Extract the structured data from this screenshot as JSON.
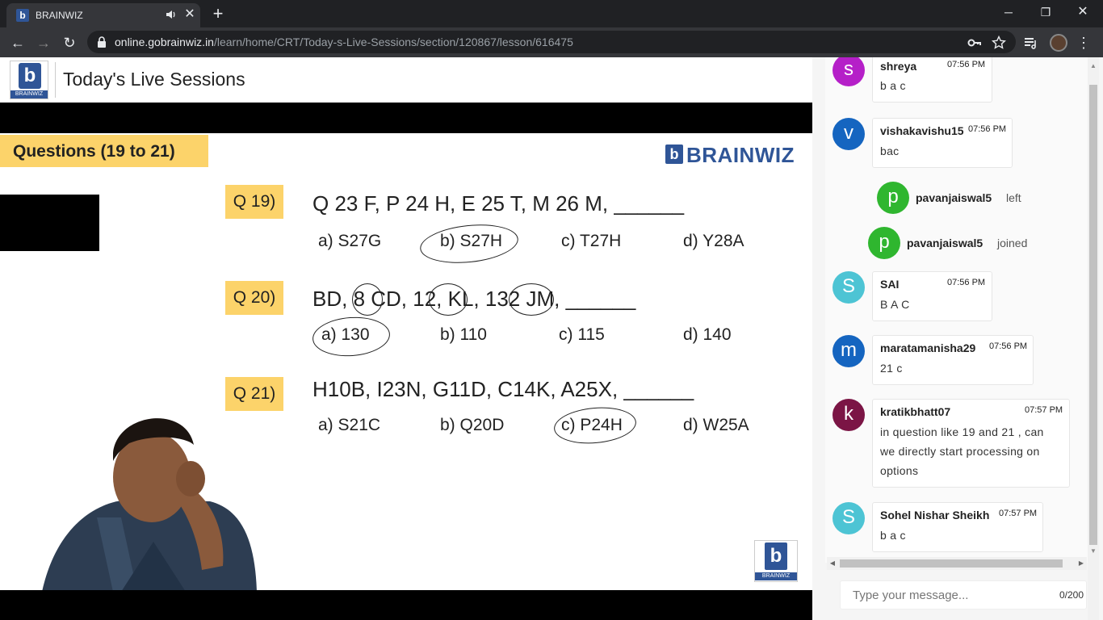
{
  "browser": {
    "tab_title": "BRAINWIZ",
    "new_tab": "+",
    "url_host": "online.gobrainwiz.in",
    "url_path": "/learn/home/CRT/Today-s-Live-Sessions/section/120867/lesson/616475",
    "minimize": "─",
    "restore": "❐",
    "close": "✕",
    "back": "←",
    "forward": "→",
    "reload": "↻",
    "menu": "⋮"
  },
  "site": {
    "logo_text": "BRAINWIZ",
    "page_title": "Today's Live Sessions"
  },
  "slide": {
    "banner": "Questions (19 to 21)",
    "brand": "BRAINWIZ",
    "questions": [
      {
        "label": "Q 19)",
        "text": "Q 23 F,   P 24 H,   E 25 T,   M 26 M,  ______",
        "options": [
          "a) S27G",
          "b) S27H",
          "c) T27H",
          "d) Y28A"
        ]
      },
      {
        "label": "Q 20)",
        "text": "BD,  8  CD,  12,  KL,  132   JM,  ______",
        "options": [
          "a) 130",
          "b) 110",
          "c) 115",
          "d) 140"
        ]
      },
      {
        "label": "Q 21)",
        "text": "H10B,   I23N,   G11D,   C14K,  A25X,  ______",
        "options": [
          "a) S21C",
          "b) Q20D",
          "c) P24H",
          "d) W25A"
        ]
      }
    ],
    "corner_logo": "BRAINWIZ"
  },
  "chat": {
    "messages": [
      {
        "initial": "s",
        "color": "#b51fc8",
        "user": "shreya",
        "time": "07:56 PM",
        "text": "b a c"
      },
      {
        "initial": "v",
        "color": "#1565c0",
        "user": "vishakavishu15",
        "time": "07:56 PM",
        "text": "bac"
      },
      {
        "initial": "S",
        "color": "#4dc4d4",
        "user": "SAI",
        "time": "07:56 PM",
        "text": "B A C"
      },
      {
        "initial": "m",
        "color": "#1565c0",
        "user": "maratamanisha29",
        "time": "07:56 PM",
        "text": "21 c"
      },
      {
        "initial": "k",
        "color": "#7b1545",
        "user": "kratikbhatt07",
        "time": "07:57 PM",
        "text_lines": [
          "in question like 19 and 21 , can",
          "we directly start processing on",
          "options"
        ]
      },
      {
        "initial": "S",
        "color": "#4dc4d4",
        "user": "Sohel Nishar Sheikh",
        "time": "07:57 PM",
        "text": "b a c"
      }
    ],
    "events": [
      {
        "initial": "p",
        "color": "#2fb62f",
        "user": "pavanjaiswal5",
        "action": "left"
      },
      {
        "initial": "p",
        "color": "#2fb62f",
        "user": "pavanjaiswal5",
        "action": "joined"
      }
    ],
    "input_placeholder": "Type your message...",
    "char_count": "0/200"
  }
}
